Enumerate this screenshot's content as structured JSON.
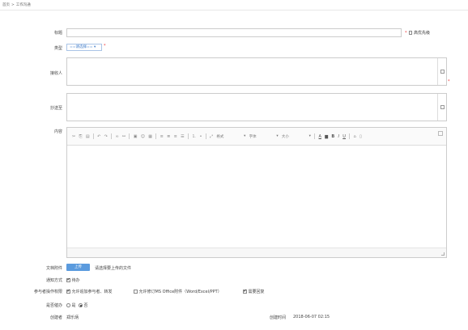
{
  "breadcrumb": {
    "home": "首页",
    "sep": ">",
    "current": "工作沟通"
  },
  "form": {
    "title_label": "标题",
    "urgent_label": "高优先级",
    "type_label": "类型",
    "type_value": "==请选择== ▾",
    "recipient_label": "接收人",
    "cc_label": "抄送至",
    "content_label": "内容",
    "attach_label": "文档附件",
    "upload_button": "上传",
    "upload_hint": "请选择要上传的文件",
    "notify_label": "通知方式",
    "notify_option": "待办",
    "permission_label": "参与者操作权限",
    "perm_options": [
      {
        "label": "允许追加参与者、转发",
        "checked": true
      },
      {
        "label": "允许修订MS Office附件（Word/Excel/PPT）",
        "checked": false
      },
      {
        "label": "需要回复",
        "checked": true
      }
    ],
    "tracking_label": "是否催办",
    "tracking_yes": "是",
    "tracking_no": "否",
    "creator_label": "创建者",
    "creator_value": "郑乐炳",
    "created_time_label": "创建时间",
    "created_time_value": "2018-06-07 02:15"
  },
  "toolbar": {
    "format_label": "格式",
    "font_label": "字体",
    "size_label": "大小",
    "dropdown_arrow": "▾",
    "bold": "B",
    "italic": "I",
    "underline": "U"
  }
}
